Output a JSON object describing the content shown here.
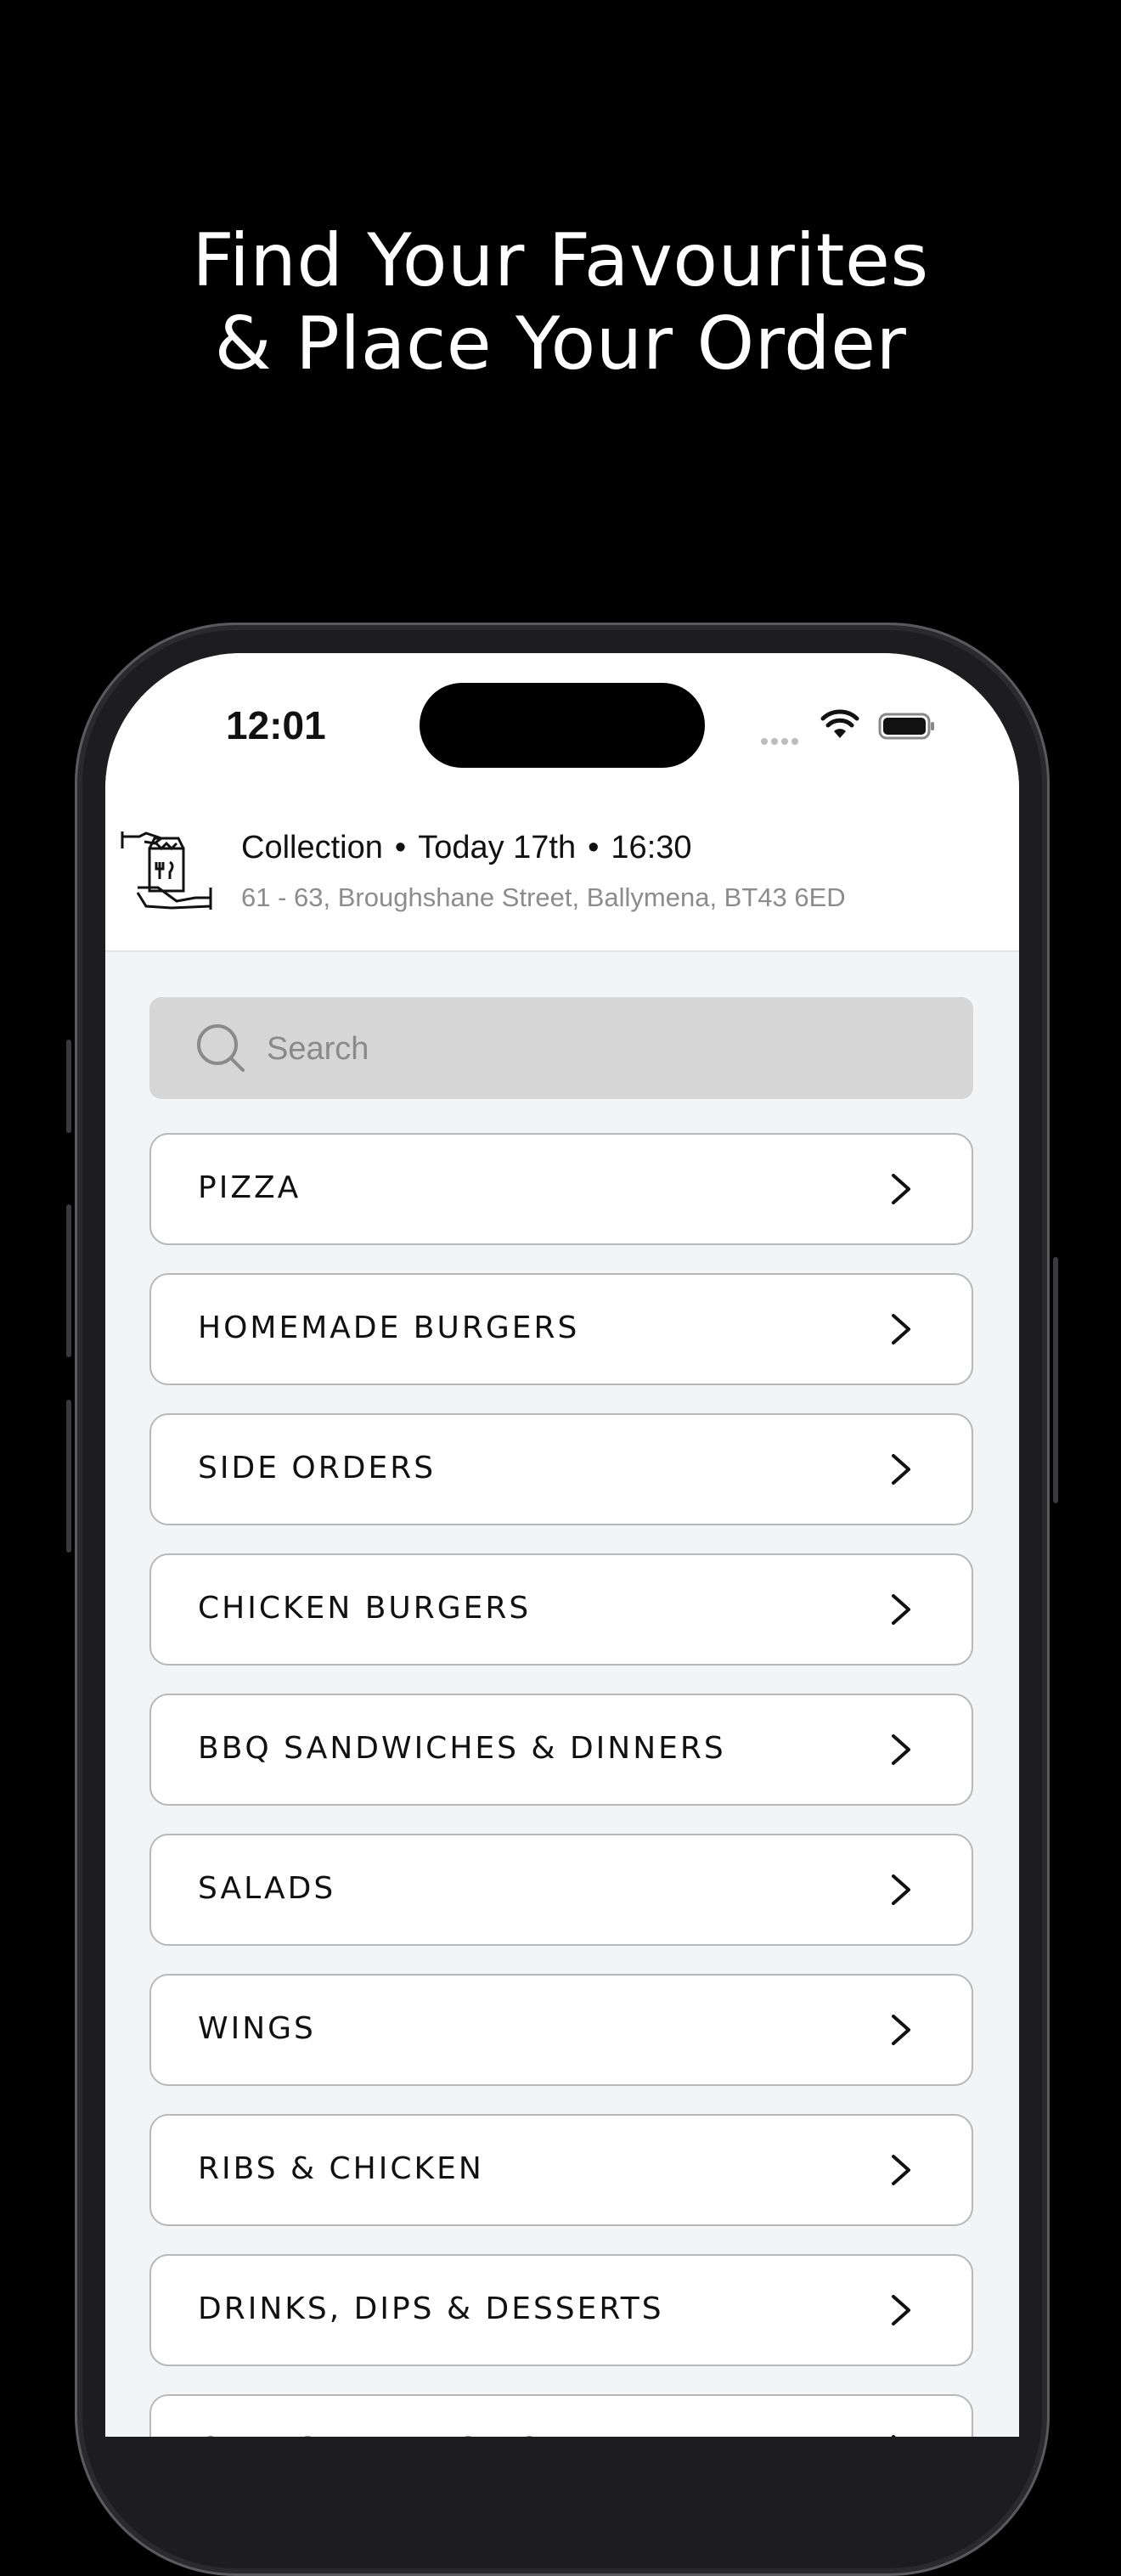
{
  "headline": {
    "line1": "Find Your Favourites",
    "line2": "& Place Your Order"
  },
  "status_bar": {
    "time": "12:01"
  },
  "order": {
    "method": "Collection",
    "day": "Today 17th",
    "time": "16:30",
    "address": "61 - 63,  Broughshane Street, Ballymena, BT43  6ED"
  },
  "search": {
    "placeholder": "Search"
  },
  "categories": [
    "PIZZA",
    "HOMEMADE BURGERS",
    "SIDE ORDERS",
    "CHICKEN BURGERS",
    "BBQ SANDWICHES & DINNERS",
    "SALADS",
    "WINGS",
    "RIBS & CHICKEN",
    "DRINKS, DIPS & DESSERTS",
    "CHARGRILLED CHICKEN"
  ],
  "colors": {
    "background": "#000000",
    "screen_background": "#f3f4f6",
    "search_background": "#d6d6d6",
    "card_border": "#b8b8b8"
  }
}
